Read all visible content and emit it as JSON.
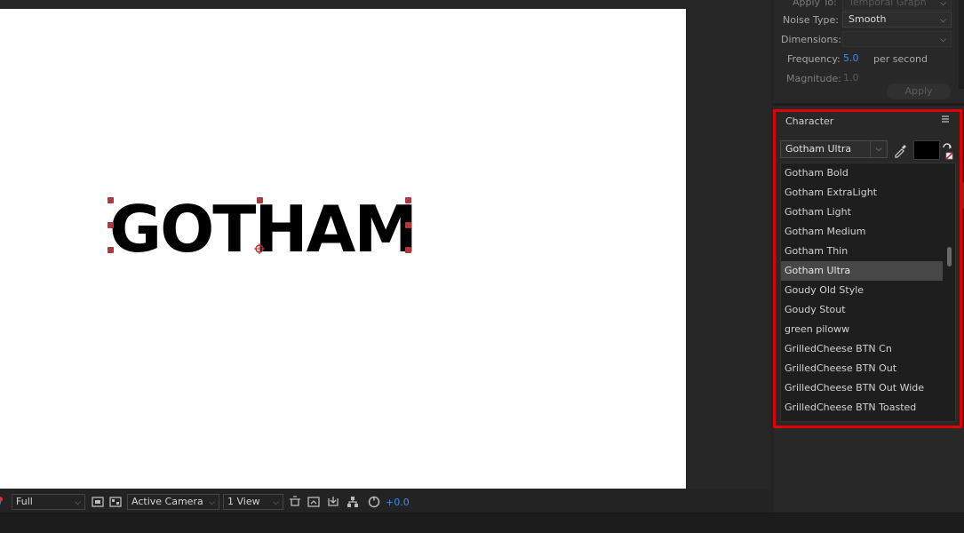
{
  "viewer": {
    "canvas_text": "GOTHAM",
    "toolbar": {
      "resolution": "Full",
      "camera": "Active Camera",
      "views": "1 View",
      "exposure": "+0.0",
      "icons": [
        "color-channel-icon",
        "region-of-interest-icon",
        "transparency-grid-icon",
        "3d-draft-icon",
        "snapshot-icon",
        "show-snapshot-icon",
        "channel-icon",
        "flowchart-icon",
        "reset-exposure-icon"
      ]
    }
  },
  "wiggler": {
    "apply_to_label": "Apply To:",
    "apply_to_value": "Temporal Graph",
    "noise_type_label": "Noise Type:",
    "noise_type_value": "Smooth",
    "dimensions_label": "Dimensions:",
    "dimensions_value": "",
    "frequency_label": "Frequency:",
    "frequency_value": "5.0",
    "frequency_unit": "per second",
    "magnitude_label": "Magnitude:",
    "magnitude_value": "1.0",
    "apply_button": "Apply"
  },
  "character": {
    "title": "Character",
    "selected_font": "Gotham Ultra",
    "fill_color": "#000000",
    "fonts": [
      {
        "name": "Gotham Bold",
        "selected": false
      },
      {
        "name": "Gotham ExtraLight",
        "selected": false
      },
      {
        "name": "Gotham Light",
        "selected": false
      },
      {
        "name": "Gotham Medium",
        "selected": false
      },
      {
        "name": "Gotham Thin",
        "selected": false
      },
      {
        "name": "Gotham Ultra",
        "selected": true
      },
      {
        "name": "Goudy Old Style",
        "selected": false
      },
      {
        "name": "Goudy Stout",
        "selected": false
      },
      {
        "name": "green piloww",
        "selected": false
      },
      {
        "name": "GrilledCheese BTN Cn",
        "selected": false
      },
      {
        "name": "GrilledCheese BTN Out",
        "selected": false
      },
      {
        "name": "GrilledCheese BTN Out Wide",
        "selected": false
      },
      {
        "name": "GrilledCheese BTN Toasted",
        "selected": false
      }
    ]
  },
  "colors": {
    "highlight": "#e00000",
    "accent_blue": "#3b8cf0",
    "handle": "#b0383d"
  }
}
